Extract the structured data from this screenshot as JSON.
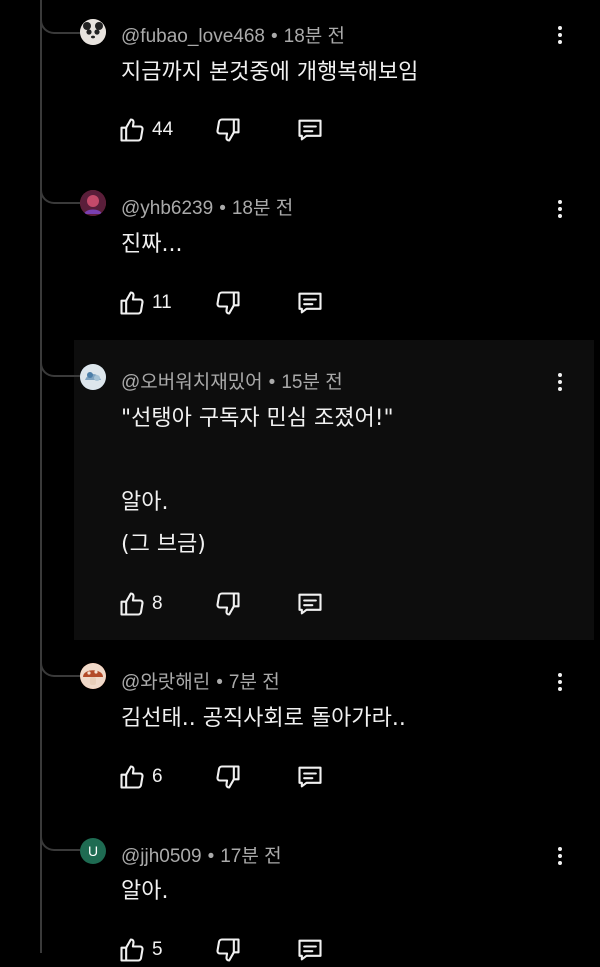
{
  "comments": [
    {
      "author": "@fubao_love468",
      "time": "18분 전",
      "text": "지금까지 본것중에 개행복해보임",
      "likes": "44",
      "avatar_color": "#d9d4cf"
    },
    {
      "author": "@yhb6239",
      "time": "18분 전",
      "text": "진짜...",
      "likes": "11",
      "avatar_color": "#8a2d3c"
    },
    {
      "author": "@오버워치재밌어",
      "time": "15분 전",
      "text": "\"선탱아 구독자 민심 조졌어!\"\n\n알아.\n(그 브금)",
      "likes": "8",
      "avatar_color": "#9fb8c9"
    },
    {
      "author": "@와랏해린",
      "time": "7분 전",
      "text": "김선태.. 공직사회로 돌아가라..",
      "likes": "6",
      "avatar_color": "#c0603a"
    },
    {
      "author": "@jjh0509",
      "time": "17분 전",
      "text": "알아.",
      "likes": "5",
      "avatar_color": "#1e6b52",
      "avatar_letter": "U"
    }
  ],
  "icons": {
    "like": "thumbs-up-icon",
    "dislike": "thumbs-down-icon",
    "reply": "comment-icon",
    "more": "more-vert-icon"
  },
  "separator": "•"
}
